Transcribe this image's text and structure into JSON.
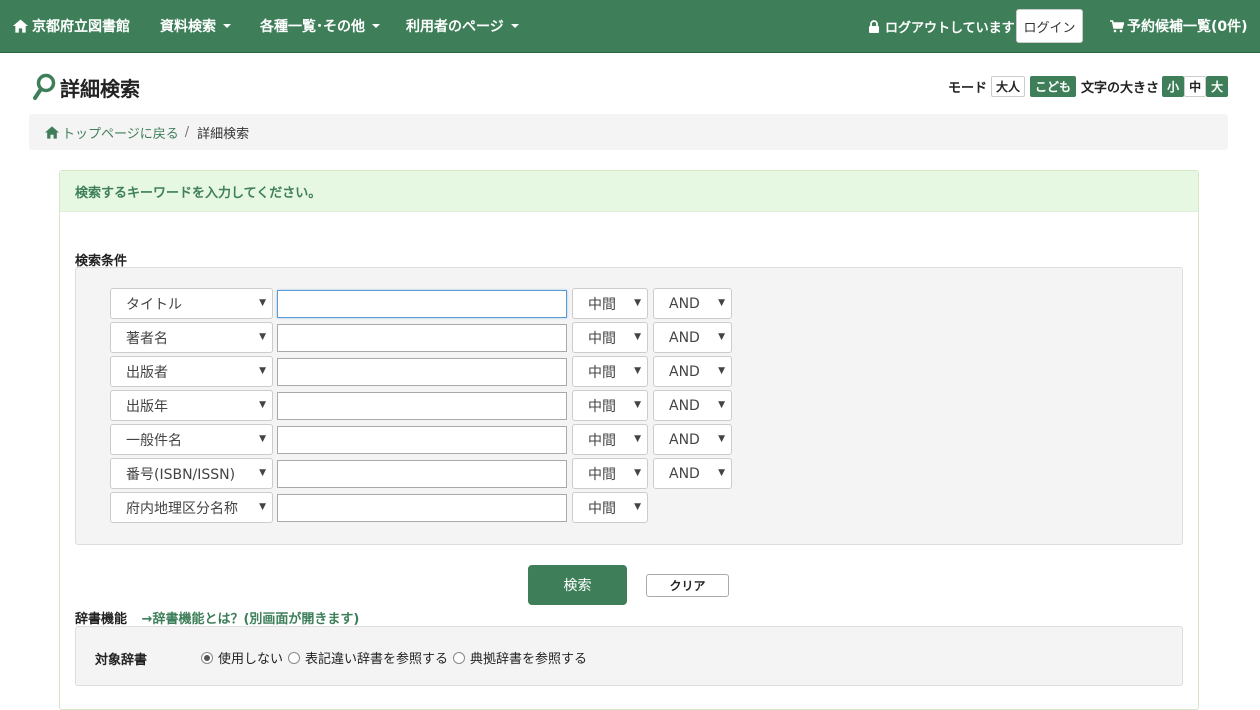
{
  "nav": {
    "brand": "京都府立図書館",
    "menu1": "資料検索",
    "menu2": "各種一覧･その他",
    "menu3": "利用者のページ",
    "logout_status": "ログアウトしています",
    "login": "ログイン",
    "cart": "予約候補一覧(0件)"
  },
  "page": {
    "title": "詳細検索"
  },
  "mode": {
    "label": "モード",
    "adult": "大人",
    "kids": "こども",
    "font_label": "文字の大きさ",
    "small": "小",
    "medium": "中",
    "large": "大"
  },
  "breadcrumb": {
    "home": "トップページに戻る",
    "sep": "/",
    "current": "詳細検索"
  },
  "search": {
    "instruction": "検索するキーワードを入力してください。",
    "conditions_label": "検索条件",
    "rows": [
      {
        "field": "タイトル",
        "match": "中間",
        "op": "AND"
      },
      {
        "field": "著者名",
        "match": "中間",
        "op": "AND"
      },
      {
        "field": "出版者",
        "match": "中間",
        "op": "AND"
      },
      {
        "field": "出版年",
        "match": "中間",
        "op": "AND"
      },
      {
        "field": "一般件名",
        "match": "中間",
        "op": "AND"
      },
      {
        "field": "番号(ISBN/ISSN)",
        "match": "中間",
        "op": "AND"
      },
      {
        "field": "府内地理区分名称",
        "match": "中間"
      }
    ],
    "search_button": "検索",
    "clear_button": "クリア"
  },
  "dictionary": {
    "label": "辞書機能",
    "link": "→辞書機能とは？(別画面が開きます)",
    "target_label": "対象辞書",
    "options": [
      "使用しない",
      "表記違い辞書を参照する",
      "典拠辞書を参照する"
    ]
  },
  "colors": {
    "brand_green": "#3e7f5a",
    "notice_bg": "#e7f8e2",
    "panel_gray": "#f4f4f4"
  }
}
